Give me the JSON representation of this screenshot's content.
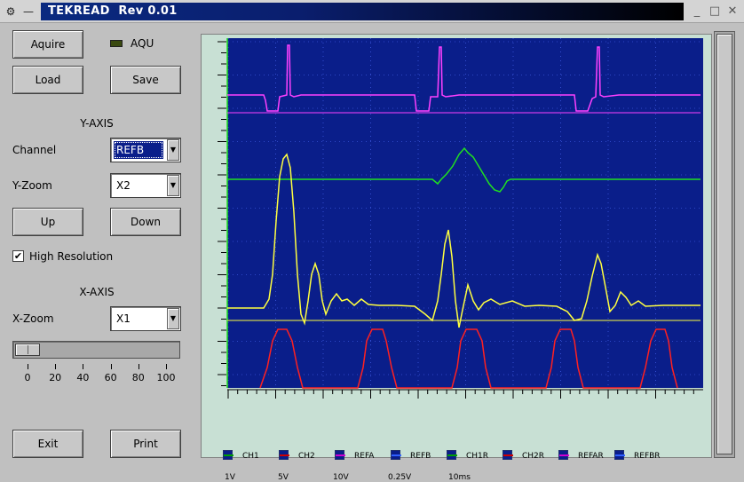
{
  "window": {
    "title": "TEKREAD  Rev 0.01"
  },
  "buttons": {
    "aquire": "Aquire",
    "load": "Load",
    "save": "Save",
    "up": "Up",
    "down": "Down",
    "exit": "Exit",
    "print": "Print"
  },
  "indicator": {
    "aqu_label": "AQU",
    "led_color": "#3a4a10"
  },
  "y_axis": {
    "title": "Y-AXIS",
    "channel_label": "Channel",
    "channel_value": "REFB",
    "zoom_label": "Y-Zoom",
    "zoom_value": "X2"
  },
  "high_resolution": {
    "label": "High Resolution",
    "checked": true
  },
  "x_axis": {
    "title": "X-AXIS",
    "zoom_label": "X-Zoom",
    "zoom_value": "X1",
    "slider_value": 0,
    "slider_labels": [
      "0",
      "20",
      "40",
      "60",
      "80",
      "100"
    ]
  },
  "legend": [
    {
      "name": "CH1",
      "color": "#00a000"
    },
    {
      "name": "CH2",
      "color": "#d00000"
    },
    {
      "name": "REFA",
      "color": "#d000d0"
    },
    {
      "name": "REFB",
      "color": "#3060ff"
    },
    {
      "name": "CH1R",
      "color": "#00a000"
    },
    {
      "name": "CH2R",
      "color": "#d00000"
    },
    {
      "name": "REFAR",
      "color": "#d000d0"
    },
    {
      "name": "REFBR",
      "color": "#3060ff"
    }
  ],
  "scales": [
    "1V",
    "5V",
    "10V",
    "0.25V",
    "10ms"
  ],
  "colors": {
    "screen": "#0a1e8a",
    "trace_magenta": "#ff40ff",
    "trace_yellow": "#ffff40",
    "trace_green": "#20e020",
    "trace_red": "#ff2020",
    "grid": "#6060ff"
  }
}
